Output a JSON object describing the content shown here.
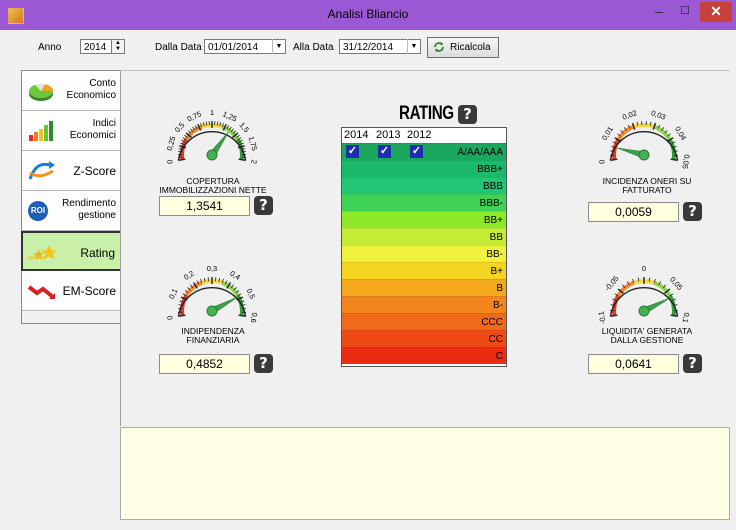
{
  "window": {
    "title": "Analisi Bliancio"
  },
  "toolbar": {
    "anno_label": "Anno",
    "anno_value": "2014",
    "dalla_data_label": "Dalla Data",
    "dalla_data_value": "01/01/2014",
    "alla_data_label": "Alla Data",
    "alla_data_value": "31/12/2014",
    "ricalcola_label": "Ricalcola"
  },
  "sidebar": {
    "items": [
      {
        "label_line1": "Conto",
        "label_line2": "Economico"
      },
      {
        "label_line1": "Indici",
        "label_line2": "Economici"
      },
      {
        "label_line1": "Z-Score"
      },
      {
        "label_line1": "Rendimento",
        "label_line2": "gestione",
        "icon_text": "ROI"
      },
      {
        "label_line1": "Rating"
      },
      {
        "label_line1": "EM-Score"
      }
    ],
    "active": "Rating"
  },
  "rating": {
    "title": "RATING",
    "help": "?",
    "years": [
      "2014",
      "2013",
      "2012"
    ],
    "checks": [
      "✓",
      "✓",
      "✓"
    ],
    "classes": [
      "A/AA/AAA",
      "BBB+",
      "BBB",
      "BBB-",
      "BB+",
      "BB",
      "BB-",
      "B+",
      "B",
      "B-",
      "CCC",
      "CC",
      "C"
    ],
    "class_colors": [
      "#1aa85e",
      "#1bb96a",
      "#22c776",
      "#3fd257",
      "#8ee82a",
      "#c4ec35",
      "#eef23c",
      "#f5d321",
      "#f4a81c",
      "#f2861c",
      "#f06a1a",
      "#ee4a16",
      "#eb2b12"
    ]
  },
  "gauges": [
    {
      "id": "copertura",
      "label_line1": "COPERTURA",
      "label_line2": "IMMOBILIZZAZIONI NETTE",
      "value": "1,3541",
      "ticks": [
        "0",
        "0,25",
        "0,5",
        "0,75",
        "1",
        "1,25",
        "1,5",
        "1,75",
        "2"
      ],
      "needle_fraction": 0.68
    },
    {
      "id": "incidenza",
      "label_line1": "INCIDENZA ONERI SU",
      "label_line2": "FATTURATO",
      "value": "0,0059",
      "ticks": [
        "0",
        "0,01",
        "0,02",
        "0,03",
        "0,04",
        "0,05"
      ],
      "needle_fraction": 0.12
    },
    {
      "id": "indipendenza",
      "label_line1": "INDIPENDENZA",
      "label_line2": "FINANZIARIA",
      "value": "0,4852",
      "ticks": [
        "0",
        "0,1",
        "0,2",
        "0,3",
        "0,4",
        "0,5",
        "0,6"
      ],
      "needle_fraction": 0.81
    },
    {
      "id": "liquidita",
      "label_line1": "LIQUIDITA' GENERATA",
      "label_line2": "DALLA GESTIONE",
      "value": "0,0641",
      "ticks": [
        "-0,1",
        "-0,05",
        "0",
        "0,05",
        "0,1"
      ],
      "needle_fraction": 0.82
    }
  ],
  "help_glyph": "?"
}
